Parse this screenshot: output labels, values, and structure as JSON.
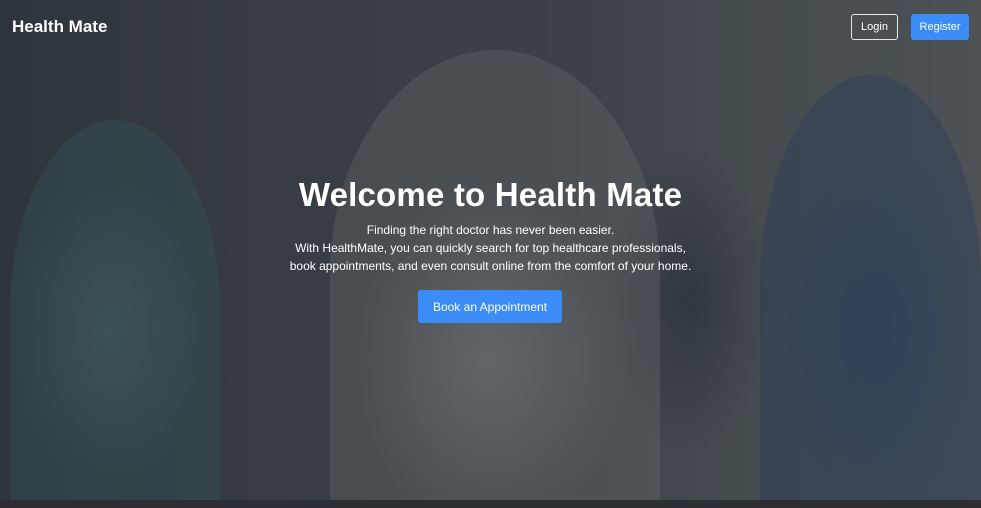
{
  "navbar": {
    "brand": "Health Mate",
    "login_label": "Login",
    "register_label": "Register"
  },
  "hero": {
    "title": "Welcome to Health Mate",
    "lines": [
      "Finding the right doctor has never been easier.",
      "With HealthMate, you can quickly search for top healthcare professionals,",
      "book appointments, and even consult online from the comfort of your home."
    ],
    "cta_label": "Book an Appointment"
  },
  "colors": {
    "accent": "#3b8cf7",
    "text": "#ffffff"
  }
}
